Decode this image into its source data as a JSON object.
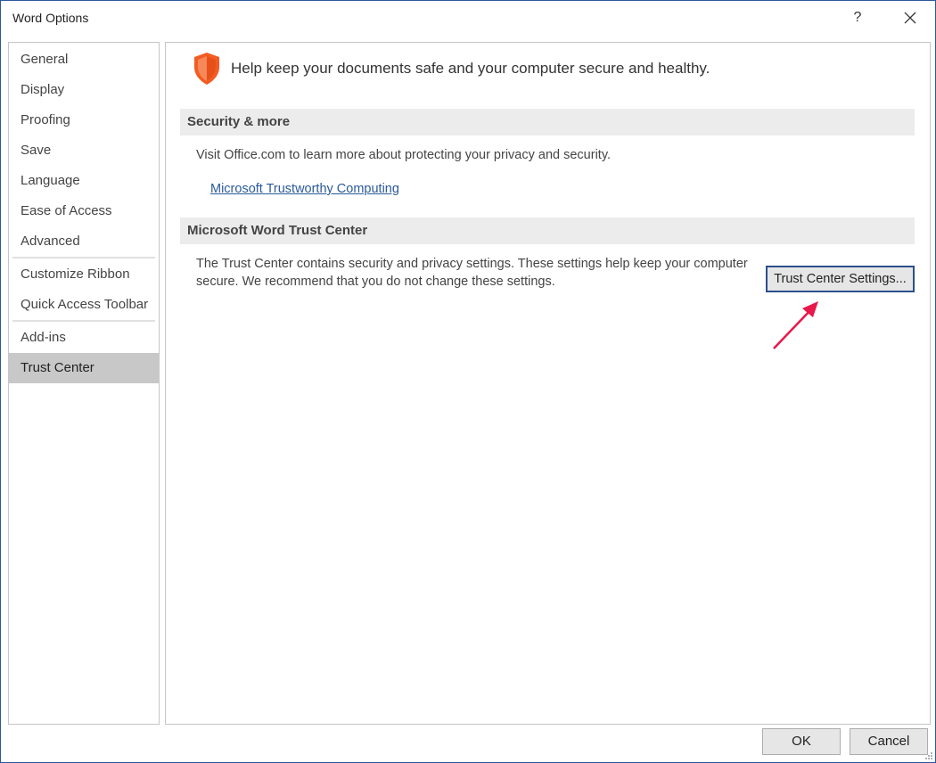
{
  "window": {
    "title": "Word Options",
    "help_label": "?"
  },
  "sidebar": {
    "items": [
      {
        "label": "General"
      },
      {
        "label": "Display"
      },
      {
        "label": "Proofing"
      },
      {
        "label": "Save"
      },
      {
        "label": "Language"
      },
      {
        "label": "Ease of Access"
      },
      {
        "label": "Advanced"
      },
      {
        "label": "Customize Ribbon"
      },
      {
        "label": "Quick Access Toolbar"
      },
      {
        "label": "Add-ins"
      },
      {
        "label": "Trust Center",
        "selected": true
      }
    ]
  },
  "main": {
    "header_icon": "shield-icon",
    "header_text": "Help keep your documents safe and your computer secure and healthy.",
    "security_section": {
      "title": "Security & more",
      "description": "Visit Office.com to learn more about protecting your privacy and security.",
      "link": "Microsoft Trustworthy Computing"
    },
    "trust_center_section": {
      "title": "Microsoft Word Trust Center",
      "description_line1": "The Trust Center contains security and privacy settings. These settings help keep your computer",
      "description_line2": "secure. We recommend that you do not change these settings.",
      "button_label": "Trust Center Settings..."
    }
  },
  "footer": {
    "ok_label": "OK",
    "cancel_label": "Cancel"
  },
  "colors": {
    "accent": "#2b579a",
    "shield": "#f25c22",
    "selected_nav": "#c8c8c8",
    "annotation_arrow": "#e8184a"
  }
}
